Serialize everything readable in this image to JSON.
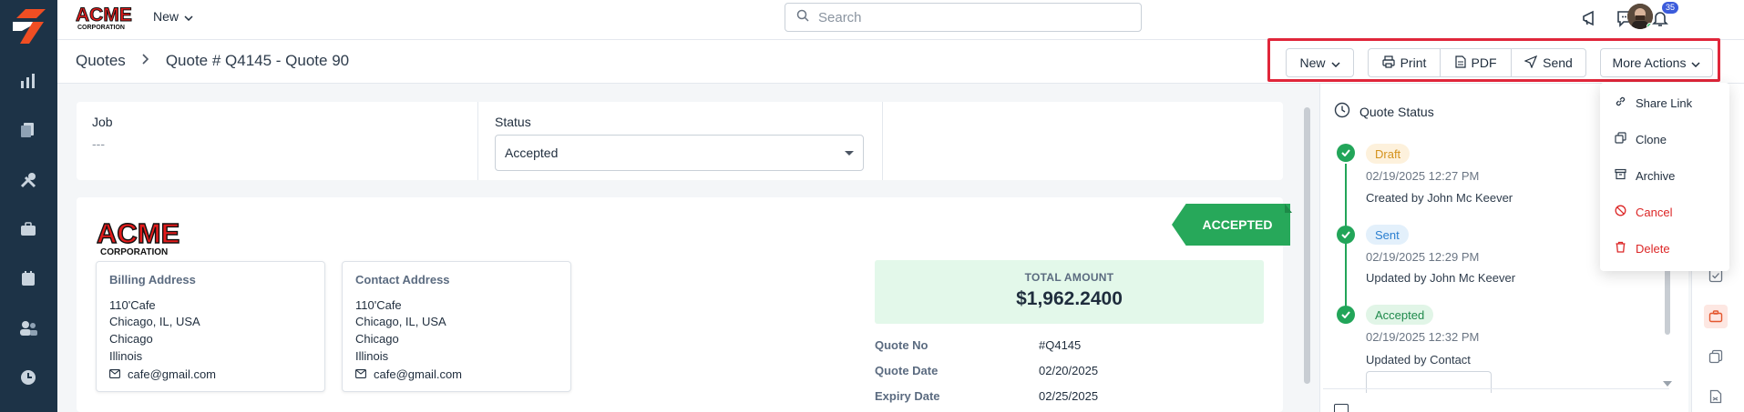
{
  "topbar": {
    "new_label": "New",
    "search_placeholder": "Search",
    "notifications_count": "35",
    "brand_logo_text": "ACME CORPORATION"
  },
  "breadcrumb": {
    "root": "Quotes",
    "current": "Quote # Q4145 - Quote 90"
  },
  "actions": {
    "new": "New",
    "print": "Print",
    "pdf": "PDF",
    "send": "Send",
    "more": "More Actions"
  },
  "job": {
    "label": "Job",
    "value": "---"
  },
  "status": {
    "label": "Status",
    "selected": "Accepted"
  },
  "quote": {
    "ribbon": "ACCEPTED",
    "total_label": "TOTAL AMOUNT",
    "total_value": "$1,962.2400",
    "billing": {
      "title": "Billing Address",
      "lines": [
        "110'Cafe",
        "Chicago, IL, USA",
        "Chicago",
        "Illinois"
      ],
      "email": "cafe@gmail.com"
    },
    "contact": {
      "title": "Contact Address",
      "lines": [
        "110'Cafe",
        "Chicago, IL, USA",
        "Chicago",
        "Illinois"
      ],
      "email": "cafe@gmail.com"
    },
    "details": [
      {
        "key": "Quote No",
        "value": "#Q4145"
      },
      {
        "key": "Quote Date",
        "value": "02/20/2025"
      },
      {
        "key": "Expiry Date",
        "value": "02/25/2025"
      }
    ]
  },
  "quote_status": {
    "title": "Quote Status",
    "events": [
      {
        "status": "Draft",
        "time": "02/19/2025 12:27 PM",
        "desc": "Created by John Mc Keever"
      },
      {
        "status": "Sent",
        "time": "02/19/2025 12:29 PM",
        "desc": "Updated by John Mc Keever"
      },
      {
        "status": "Accepted",
        "time": "02/19/2025 12:32 PM",
        "desc": "Updated by Contact"
      }
    ]
  },
  "more_menu": {
    "items": [
      "Share Link",
      "Clone",
      "Archive",
      "Cancel",
      "Delete"
    ]
  },
  "colors": {
    "sidebar": "#1d3347",
    "accent_green": "#22a559",
    "highlight_red": "#e0263a",
    "danger": "#dc2626"
  }
}
